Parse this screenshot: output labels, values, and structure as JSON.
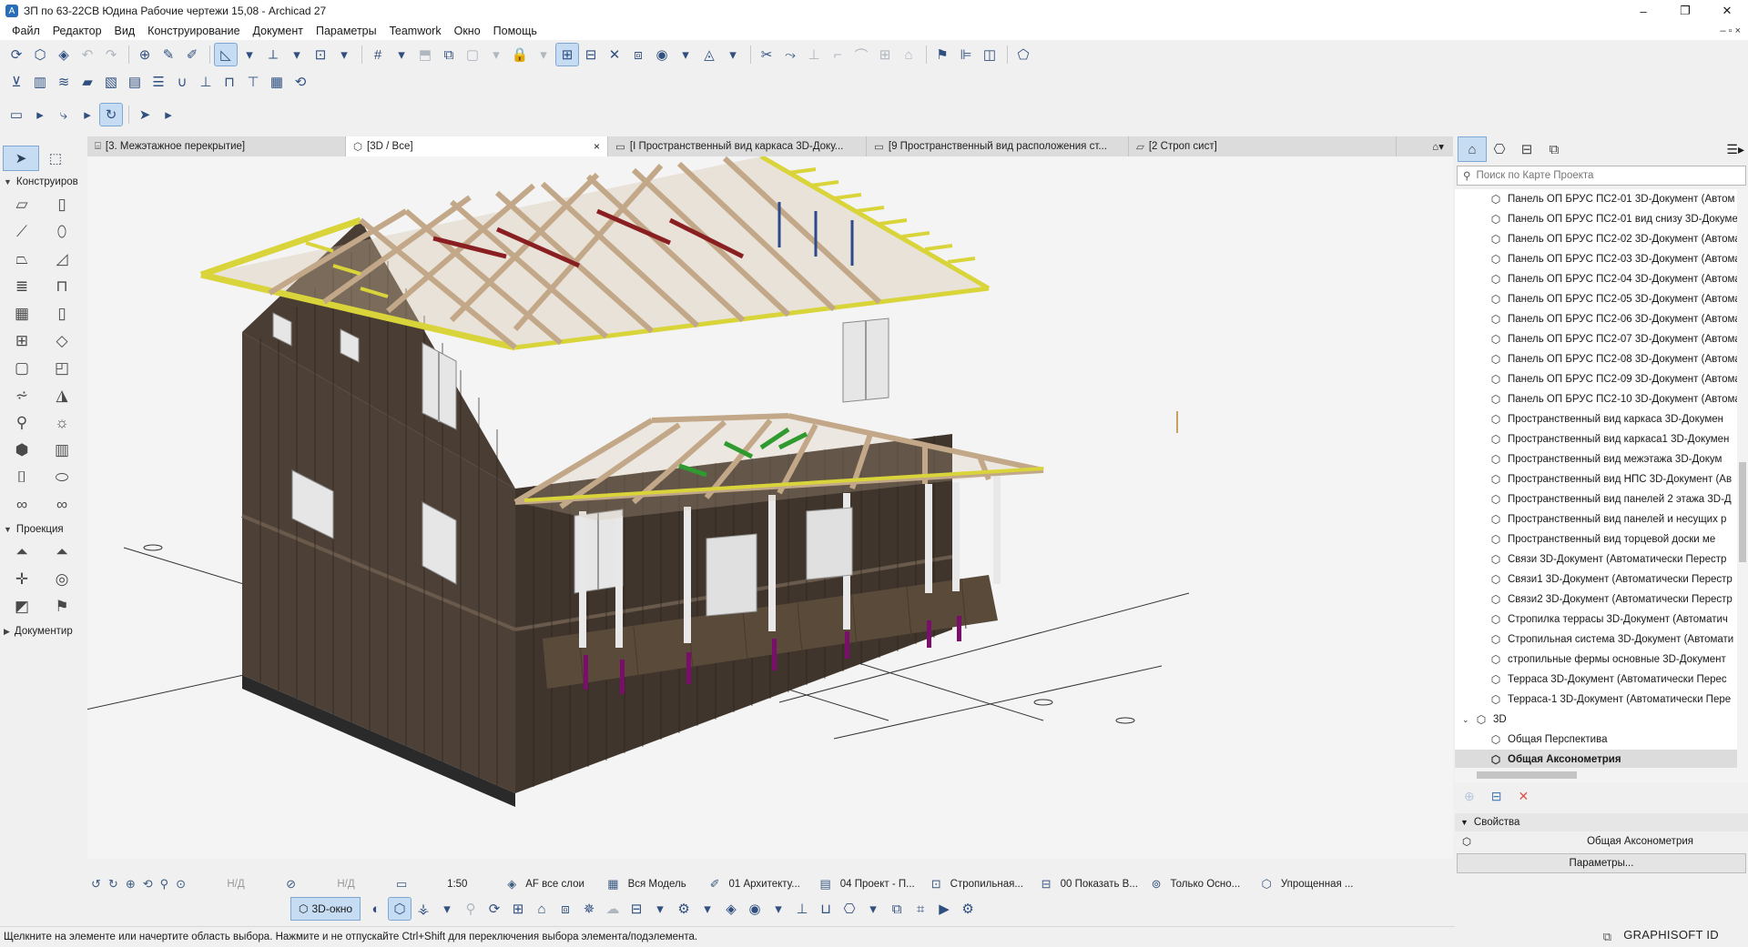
{
  "window": {
    "title": "ЗП по 63-22СВ Юдина Рабочие чертежи 15,08 - Archicad 27",
    "controls": [
      "–",
      "❐",
      "✕"
    ]
  },
  "menu": {
    "items": [
      "Файл",
      "Редактор",
      "Вид",
      "Конструирование",
      "Документ",
      "Параметры",
      "Teamwork",
      "Окно",
      "Помощь"
    ],
    "right": "– ▫ ×"
  },
  "tabs": [
    {
      "label": "[3. Межэтажное перекрытие]",
      "icon": "floor-plan-icon"
    },
    {
      "label": "[3D / Все]",
      "icon": "3d-box-icon",
      "active": true,
      "close": "×"
    },
    {
      "label": "[I Пространственный вид каркаса 3D-Доку...",
      "icon": "layout-icon"
    },
    {
      "label": "[9 Пространственный вид расположения ст...",
      "icon": "layout-icon"
    },
    {
      "label": "[2 Строп сист]",
      "icon": "folder-icon"
    }
  ],
  "left_panel": {
    "sections": [
      {
        "label": "Конструиров",
        "expanded": true
      },
      {
        "label": "Проекция",
        "expanded": true
      },
      {
        "label": "Документир",
        "expanded": false
      }
    ]
  },
  "view_status": {
    "zoom1": "Н/Д",
    "zoom2": "Н/Д",
    "scale": "1:50",
    "layers": "AF все слои",
    "model": "Вся Модель",
    "pen": "01 Архитекту...",
    "mvo": "04 Проект - П...",
    "structure": "Стропильная...",
    "renovation": "00 Показать В...",
    "filter": "Только Осно...",
    "display": "Упрощенная ..."
  },
  "bottom": {
    "button_3d": "3D-окно"
  },
  "status_line": "Щелкните на элементе или начертите область выбора. Нажмите и не отпускайте Ctrl+Shift для переключения выбора элемента/подэлемента.",
  "brand": "GRAPHISOFT ID",
  "right_panel": {
    "search_placeholder": "Поиск по Карте Проекта",
    "tree": [
      {
        "label": "Панель ОП БРУС ПС2-01  3D-Документ (Автом"
      },
      {
        "label": "Панель ОП БРУС ПС2-01 вид снизу 3D-Докуме"
      },
      {
        "label": "Панель ОП БРУС ПС2-02 3D-Документ (Автома"
      },
      {
        "label": "Панель ОП БРУС ПС2-03 3D-Документ (Автома"
      },
      {
        "label": "Панель ОП БРУС ПС2-04 3D-Документ (Автома"
      },
      {
        "label": "Панель ОП БРУС ПС2-05 3D-Документ (Автома"
      },
      {
        "label": "Панель ОП БРУС ПС2-06 3D-Документ (Автома"
      },
      {
        "label": "Панель ОП БРУС ПС2-07 3D-Документ (Автома"
      },
      {
        "label": "Панель ОП БРУС ПС2-08 3D-Документ (Автома"
      },
      {
        "label": "Панель ОП БРУС ПС2-09 3D-Документ (Автома"
      },
      {
        "label": "Панель ОП БРУС ПС2-10 3D-Документ (Автома"
      },
      {
        "label": "Пространственный вид каркаса 3D-Докумен"
      },
      {
        "label": "Пространственный вид каркаса1 3D-Докумен"
      },
      {
        "label": "Пространственный вид межэтажа 3D-Докум"
      },
      {
        "label": "Пространственный вид НПС 3D-Документ (Ав"
      },
      {
        "label": "Пространственный вид панелей 2 этажа 3D-Д"
      },
      {
        "label": "Пространственный вид панелей и несущих р"
      },
      {
        "label": "Пространственный вид торцевой доски ме"
      },
      {
        "label": "Связи 3D-Документ (Автоматически Перестр"
      },
      {
        "label": "Связи1 3D-Документ (Автоматически Перестр"
      },
      {
        "label": "Связи2 3D-Документ (Автоматически Перестр"
      },
      {
        "label": "Стропилка террасы 3D-Документ (Автоматич"
      },
      {
        "label": "Стропильная система 3D-Документ (Автомати"
      },
      {
        "label": "стропильные фермы основные 3D-Документ"
      },
      {
        "label": "Терраса 3D-Документ (Автоматически Перес"
      },
      {
        "label": "Терраса-1 3D-Документ (Автоматически Пере"
      }
    ],
    "folder_3d": "3D",
    "perspective": "Общая Перспектива",
    "axonometry": "Общая Аксонометрия",
    "properties_title": "Свойства",
    "properties_value": "Общая Аксонометрия",
    "params_button": "Параметры..."
  },
  "colors": {
    "wall": "#3f352c",
    "rafter": "#c2a888",
    "fascia": "#d9d43a",
    "brace_red": "#8a1f22",
    "brace_green": "#2f9a2f",
    "post": "#e8e8e8",
    "pier": "#7a0f6b",
    "selection": "#c6dcf3"
  }
}
